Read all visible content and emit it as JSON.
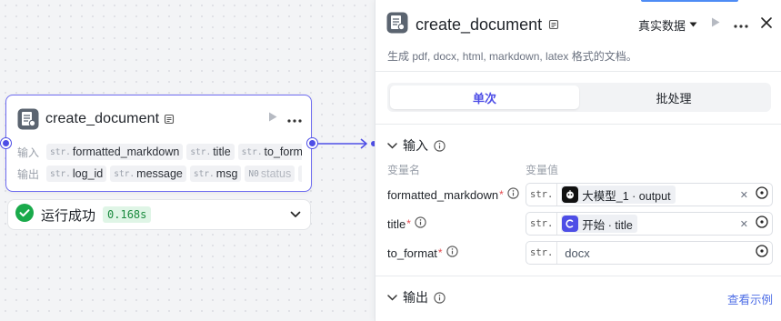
{
  "node": {
    "title": "create_document",
    "inputs_label": "输入",
    "outputs_label": "输出",
    "inputs": [
      {
        "type": "str.",
        "name": "formatted_markdown"
      },
      {
        "type": "str.",
        "name": "title"
      },
      {
        "type": "str.",
        "name": "to_format"
      }
    ],
    "outputs": [
      {
        "type": "str.",
        "name": "log_id"
      },
      {
        "type": "str.",
        "name": "message"
      },
      {
        "type": "str.",
        "name": "msg"
      },
      {
        "type": "N0",
        "name": "status"
      }
    ],
    "more": "···"
  },
  "run_status": {
    "text": "运行成功",
    "time": "0.168s",
    "color": "#1aaa4b"
  },
  "panel": {
    "title": "create_document",
    "mode": "真实数据",
    "description": "生成 pdf, docx, html, markdown, latex 格式的文档。",
    "tabs": [
      "单次",
      "批处理"
    ],
    "active_tab": 0,
    "inputs_section": "输入",
    "outputs_section": "输出",
    "view_example": "查看示例",
    "col_var_name": "变量名",
    "col_var_value": "变量值",
    "variables": [
      {
        "name": "formatted_markdown",
        "required": "*",
        "type": "str.",
        "ref_icon": "robot-icon",
        "ref": "大模型_1 · output"
      },
      {
        "name": "title",
        "required": "*",
        "type": "str.",
        "ref_icon": "start-icon",
        "ref": "开始 · title"
      },
      {
        "name": "to_format",
        "required": "*",
        "type": "str.",
        "value": "docx"
      }
    ]
  },
  "colors": {
    "accent": "#4e4ee6",
    "success": "#1aaa4b",
    "required": "#e5484d"
  }
}
